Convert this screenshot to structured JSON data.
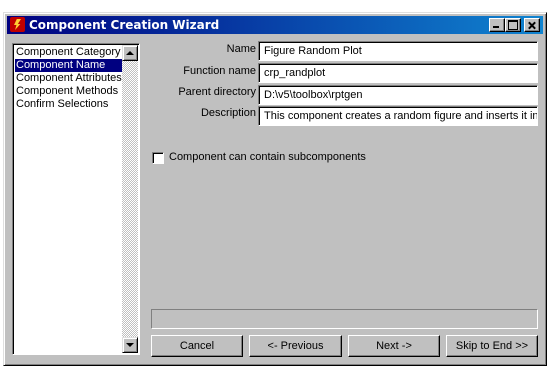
{
  "window": {
    "title": "Component Creation Wizard"
  },
  "nav": {
    "items": [
      {
        "label": "Component Category",
        "selected": false
      },
      {
        "label": "Component Name",
        "selected": true
      },
      {
        "label": "Component Attributes",
        "selected": false
      },
      {
        "label": "Component Methods",
        "selected": false
      },
      {
        "label": "Confirm Selections",
        "selected": false
      }
    ]
  },
  "form": {
    "name_label": "Name",
    "name_value": "Figure Random Plot",
    "function_label": "Function name",
    "function_value": "crp_randplot",
    "parent_label": "Parent directory",
    "parent_value": "D:\\v5\\toolbox\\rptgen",
    "description_label": "Description",
    "description_value": "This component creates a random figure and inserts it into",
    "subcomponents_label": "Component can contain subcomponents",
    "subcomponents_checked": false
  },
  "status": {
    "text": ""
  },
  "buttons": {
    "cancel": "Cancel",
    "previous": "<- Previous",
    "next": "Next ->",
    "skip": "Skip to End >>"
  }
}
